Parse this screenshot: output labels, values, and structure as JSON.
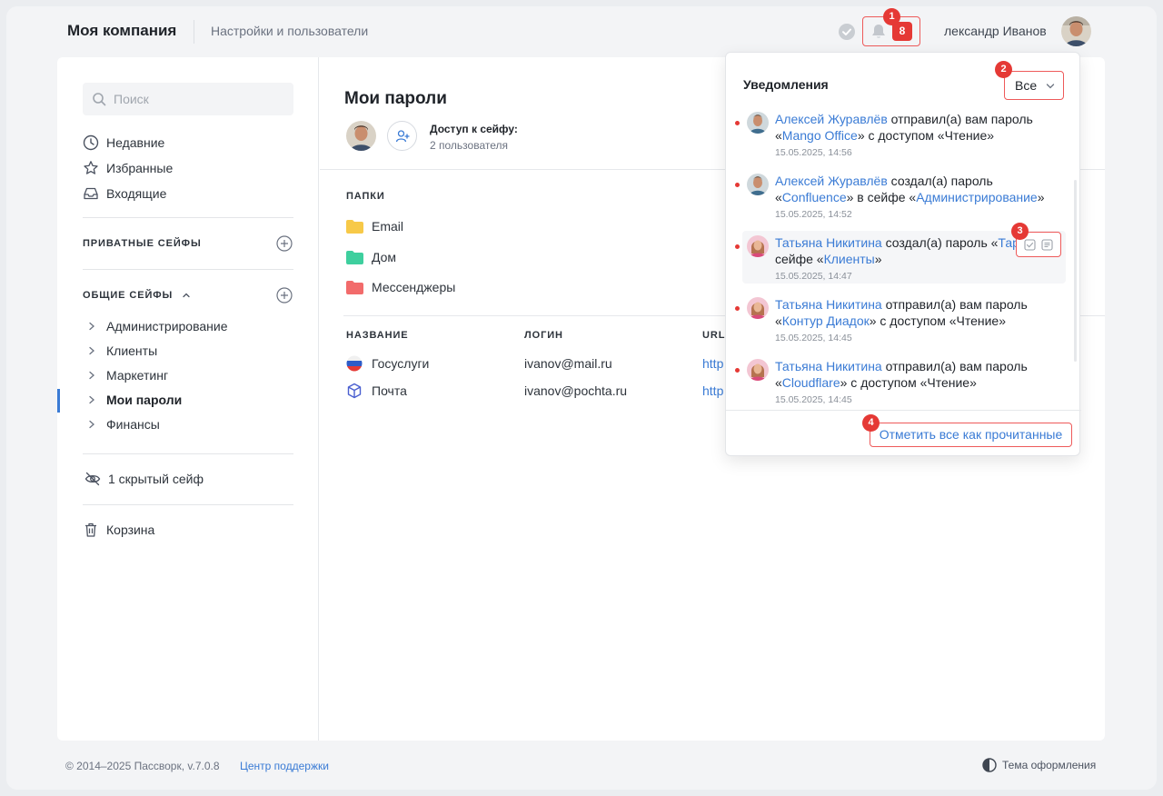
{
  "header": {
    "brand": "Моя компания",
    "subtitle": "Настройки и пользователи",
    "notifications_count": "8",
    "username": "лександр Иванов"
  },
  "markers": {
    "m1": "1",
    "m2": "2",
    "m3": "3",
    "m4": "4"
  },
  "sidebar": {
    "search_placeholder": "Поиск",
    "links": [
      {
        "label": "Недавние",
        "icon": "clock-icon"
      },
      {
        "label": "Избранные",
        "icon": "star-icon"
      },
      {
        "label": "Входящие",
        "icon": "inbox-icon"
      }
    ],
    "private_safes_label": "ПРИВАТНЫЕ СЕЙФЫ",
    "shared_safes_label": "ОБЩИЕ СЕЙФЫ",
    "shared_safes": [
      {
        "label": "Администрирование"
      },
      {
        "label": "Клиенты"
      },
      {
        "label": "Маркетинг"
      },
      {
        "label": "Мои пароли",
        "active": true
      },
      {
        "label": "Финансы"
      }
    ],
    "hidden_safes": "1 скрытый сейф",
    "trash": "Корзина"
  },
  "content": {
    "title": "Мои пароли",
    "access_label": "Доступ к сейфу:",
    "access_count": "2 пользователя",
    "folders_heading": "ПАПКИ",
    "folders": [
      {
        "name": "Email",
        "color": "#f7c948"
      },
      {
        "name": "Дом",
        "color": "#3ecf9e"
      },
      {
        "name": "Мессенджеры",
        "color": "#f26b6b"
      }
    ],
    "columns": {
      "name": "НАЗВАНИЕ",
      "login": "ЛОГИН",
      "url": "URL"
    },
    "rows": [
      {
        "name": "Госуслуги",
        "login": "ivanov@mail.ru",
        "url": "http",
        "icon": "flag-icon"
      },
      {
        "name": "Почта",
        "login": "ivanov@pochta.ru",
        "url": "http",
        "icon": "cube-icon"
      }
    ]
  },
  "notifications": {
    "title": "Уведомления",
    "filter": "Все",
    "items": [
      {
        "user": "Алексей Журавлёв",
        "a": " отправил(а) вам пароль «",
        "b": "Mango Office",
        "c": "» с доступом «Чтение»",
        "d": "",
        "e": "",
        "time": "15.05.2025, 14:56"
      },
      {
        "user": "Алексей Журавлёв",
        "a": " создал(а) пароль «",
        "b": "Confluence",
        "c": "» в сейфе «",
        "d": "Администрирование",
        "e": "»",
        "time": "15.05.2025, 14:52"
      },
      {
        "user": "Татьяна Никитина",
        "a": " создал(а) пароль «",
        "b": "Тар",
        "c": " сейфе «",
        "d": "Клиенты",
        "e": "»",
        "time": "15.05.2025, 14:47"
      },
      {
        "user": "Татьяна Никитина",
        "a": " отправил(а) вам пароль «",
        "b": "Контур Диадок",
        "c": "» с доступом «Чтение»",
        "d": "",
        "e": "",
        "time": "15.05.2025, 14:45"
      },
      {
        "user": "Татьяна Никитина",
        "a": " отправил(а) вам пароль «",
        "b": "Cloudflare",
        "c": "» с доступом «Чтение»",
        "d": "",
        "e": "",
        "time": "15.05.2025, 14:45"
      }
    ],
    "mark_all": "Отметить все как прочитанные"
  },
  "footer": {
    "copyright": "© 2014–2025 Пассворк, v.7.0.8",
    "support": "Центр поддержки",
    "theme": "Тема оформления"
  },
  "colors": {
    "accent": "#3a7bd5",
    "badge": "#e53935",
    "highlight": "#ee5a5a"
  }
}
